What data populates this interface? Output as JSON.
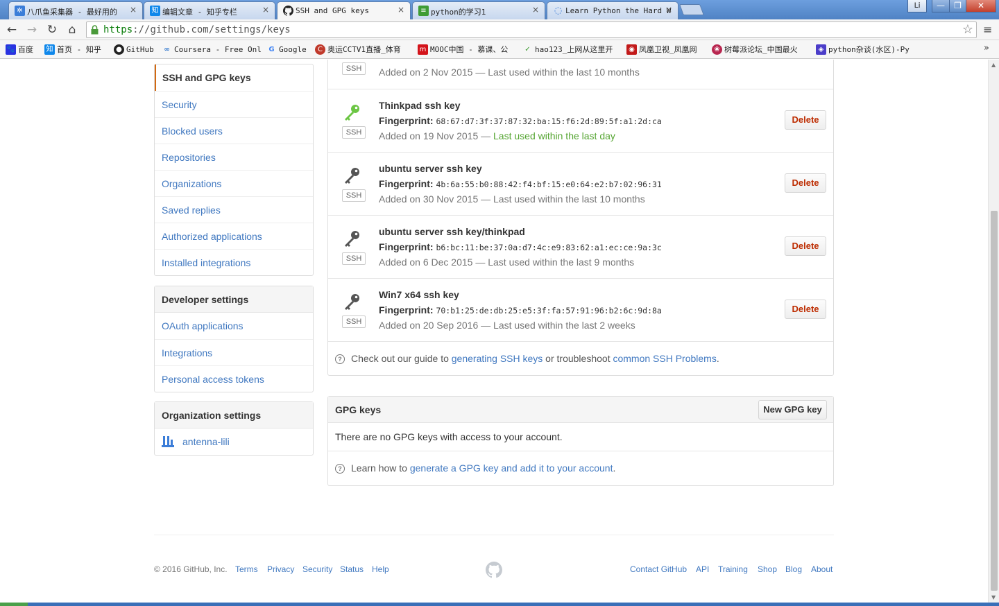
{
  "browser": {
    "tabs": [
      {
        "label": "八爪鱼采集器 - 最好用的",
        "icon": "octopus-icon",
        "color": "#3b7dd8"
      },
      {
        "label": "编辑文章 - 知乎专栏",
        "icon": "zhihu-icon",
        "color": "#0f88eb"
      },
      {
        "label": "SSH and GPG keys",
        "icon": "github-icon",
        "color": "#222222",
        "active": true
      },
      {
        "label": "python的学习1",
        "icon": "doc-icon",
        "color": "#3f9c35"
      },
      {
        "label": "Learn Python the Hard W",
        "icon": "loading-icon",
        "color": "#3b7dd8"
      }
    ],
    "window_user": "Li",
    "url_scheme": "https",
    "url_rest": "://github.com/settings/keys",
    "bookmarks": [
      {
        "label": "百度",
        "icon": "baidu-icon",
        "color": "#2932e1"
      },
      {
        "label": "首页 - 知乎",
        "icon": "zhihu-icon",
        "color": "#0f88eb"
      },
      {
        "label": "GitHub",
        "icon": "github-icon",
        "color": "#222222"
      },
      {
        "label": "Coursera - Free Onl",
        "icon": "coursera-icon",
        "color": "#2a73cc"
      },
      {
        "label": "Google",
        "icon": "google-icon",
        "color": "#4285f4"
      },
      {
        "label": "奥运CCTV1直播_体育",
        "icon": "cctv-icon",
        "color": "#c0392b"
      },
      {
        "label": "MOOC中国 - 慕课、公",
        "icon": "mooc-icon",
        "color": "#d4141b"
      },
      {
        "label": "hao123_上网从这里开",
        "icon": "hao123-icon",
        "color": "#3b9a2e"
      },
      {
        "label": "凤凰卫视_凤凰网",
        "icon": "ifeng-icon",
        "color": "#c21a1a"
      },
      {
        "label": "树莓派论坛_中国最火",
        "icon": "raspberry-icon",
        "color": "#b8264f"
      },
      {
        "label": "python杂谈(水区)-Py",
        "icon": "python-forum-icon",
        "color": "#4b3dc9"
      }
    ]
  },
  "sidebar": {
    "personal": [
      {
        "label": "SSH and GPG keys",
        "selected": true
      },
      {
        "label": "Security"
      },
      {
        "label": "Blocked users"
      },
      {
        "label": "Repositories"
      },
      {
        "label": "Organizations"
      },
      {
        "label": "Saved replies"
      },
      {
        "label": "Authorized applications"
      },
      {
        "label": "Installed integrations"
      }
    ],
    "developer": {
      "heading": "Developer settings",
      "items": [
        "OAuth applications",
        "Integrations",
        "Personal access tokens"
      ]
    },
    "organization": {
      "heading": "Organization settings",
      "org_name": "antenna-lili"
    }
  },
  "ssh_keys": {
    "partial_row": {
      "badge": "SSH",
      "added": "Added on 2 Nov 2015 — Last used within the last 10 months"
    },
    "keys": [
      {
        "title": "Thinkpad ssh key",
        "fp_label": "Fingerprint:",
        "fingerprint": "68:67:d7:3f:37:87:32:ba:15:f6:2d:89:5f:a1:2d:ca",
        "added": "Added on 19 Nov 2015 — ",
        "last_used": "Last used within the last day",
        "recent": true,
        "badge": "SSH",
        "delete": "Delete",
        "icon_color": "#6cc644"
      },
      {
        "title": "ubuntu server ssh key",
        "fp_label": "Fingerprint:",
        "fingerprint": "4b:6a:55:b0:88:42:f4:bf:15:e0:64:e2:b7:02:96:31",
        "added": "Added on 30 Nov 2015 — ",
        "last_used": "Last used within the last 10 months",
        "recent": false,
        "badge": "SSH",
        "delete": "Delete",
        "icon_color": "#555555"
      },
      {
        "title": "ubuntu server ssh key/thinkpad",
        "fp_label": "Fingerprint:",
        "fingerprint": "b6:bc:11:be:37:0a:d7:4c:e9:83:62:a1:ec:ce:9a:3c",
        "added": "Added on 6 Dec 2015 — ",
        "last_used": "Last used within the last 9 months",
        "recent": false,
        "badge": "SSH",
        "delete": "Delete",
        "icon_color": "#555555"
      },
      {
        "title": "Win7 x64 ssh key",
        "fp_label": "Fingerprint:",
        "fingerprint": "70:b1:25:de:db:25:e5:3f:fa:57:91:96:b2:6c:9d:8a",
        "added": "Added on 20 Sep 2016 — ",
        "last_used": "Last used within the last 2 weeks",
        "recent": false,
        "badge": "SSH",
        "delete": "Delete",
        "icon_color": "#555555"
      }
    ],
    "help": {
      "pre": "Check out our guide to ",
      "link1": "generating SSH keys",
      "mid": " or troubleshoot ",
      "link2": "common SSH Problems",
      "post": "."
    }
  },
  "gpg_keys": {
    "title": "GPG keys",
    "new_button": "New GPG key",
    "empty": "There are no GPG keys with access to your account.",
    "help_pre": "Learn how to ",
    "help_link": "generate a GPG key and add it to your account",
    "help_post": "."
  },
  "footer": {
    "copyright": "© 2016 GitHub, Inc.",
    "left_links": [
      "Terms",
      "Privacy",
      "Security",
      "Status",
      "Help"
    ],
    "right_links": [
      "Contact GitHub",
      "API",
      "Training",
      "Shop",
      "Blog",
      "About"
    ]
  },
  "colors": {
    "link": "#4078c0",
    "danger": "#bd2c00",
    "recent": "#55a532",
    "selected_border": "#d26911"
  }
}
